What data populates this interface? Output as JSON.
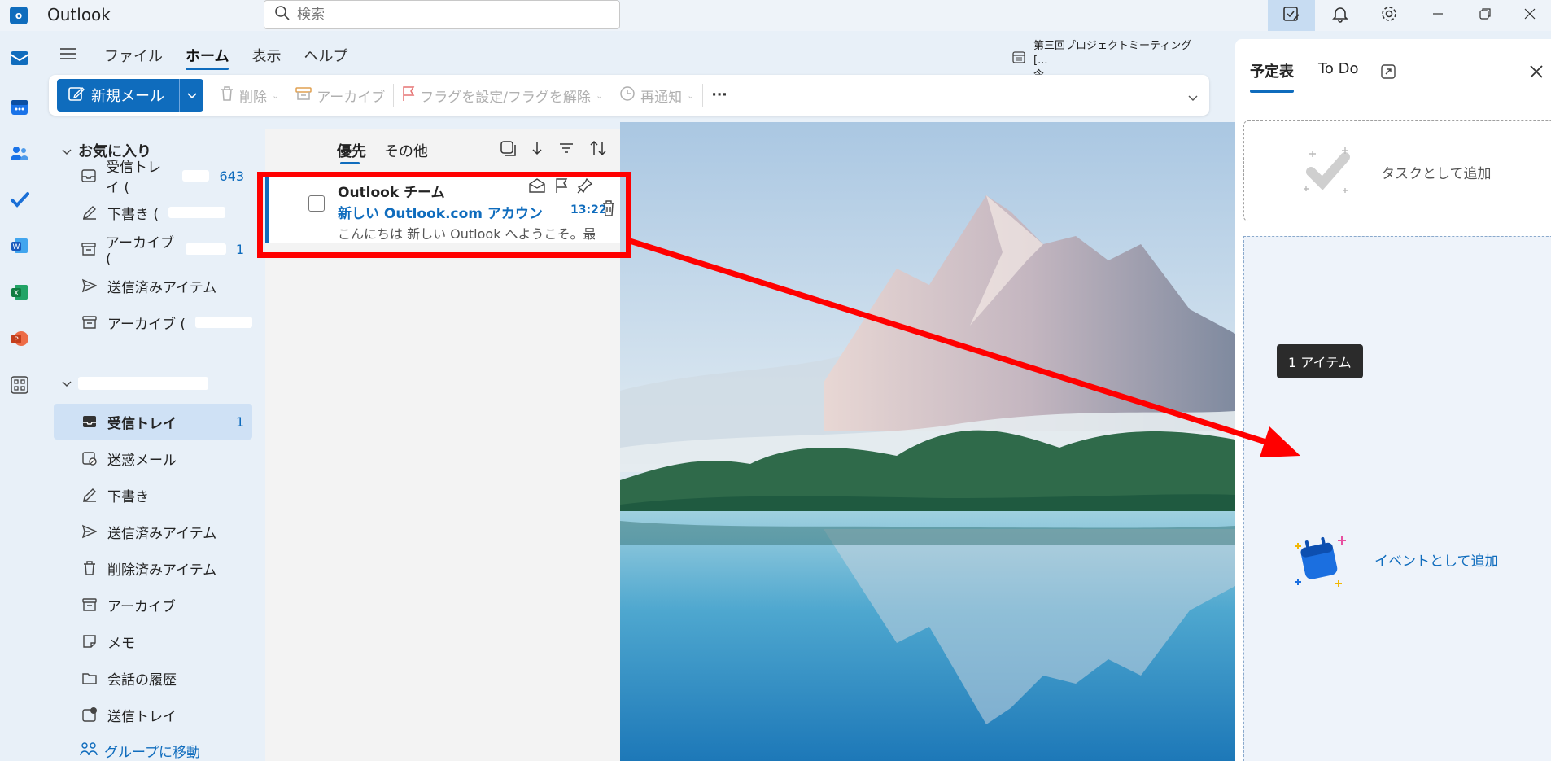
{
  "app": {
    "title": "Outlook",
    "logo_letter": "o"
  },
  "search": {
    "placeholder": "検索"
  },
  "ribbon": {
    "tabs": [
      "ファイル",
      "ホーム",
      "表示",
      "ヘルプ"
    ],
    "active_tab": "ホーム",
    "reminder": {
      "title": "第三回プロジェクトミーティング [...",
      "when": "今"
    },
    "new_mail": "新規メール",
    "tools": {
      "delete": "削除",
      "archive": "アーカイブ",
      "flag": "フラグを設定/フラグを解除",
      "snooze": "再通知",
      "more": "···"
    }
  },
  "folders": {
    "favorites_header": "お気に入り",
    "favorites": [
      {
        "label": "受信トレイ (",
        "count": "643"
      },
      {
        "label": "下書き (",
        "count": ""
      },
      {
        "label": "アーカイブ (",
        "count": "1"
      },
      {
        "label": "送信済みアイテム",
        "count": ""
      },
      {
        "label": "アーカイブ (",
        "count": ""
      }
    ],
    "account": [
      {
        "label": "受信トレイ",
        "count": "1"
      },
      {
        "label": "迷惑メール",
        "count": ""
      },
      {
        "label": "下書き",
        "count": ""
      },
      {
        "label": "送信済みアイテム",
        "count": ""
      },
      {
        "label": "削除済みアイテム",
        "count": ""
      },
      {
        "label": "アーカイブ",
        "count": ""
      },
      {
        "label": "メモ",
        "count": ""
      },
      {
        "label": "会話の履歴",
        "count": ""
      },
      {
        "label": "送信トレイ",
        "count": ""
      }
    ],
    "group_link": "グループに移動"
  },
  "message_list": {
    "tabs": [
      "優先",
      "その他"
    ],
    "active_tab": "優先",
    "message": {
      "sender": "Outlook チーム",
      "subject": "新しい Outlook.com アカウントへ...",
      "time": "13:22",
      "preview": "こんにちは 新しい Outlook へようこそ。最新..."
    }
  },
  "right_pane": {
    "tabs": [
      "予定表",
      "To Do"
    ],
    "active_tab": "予定表",
    "task_drop_label": "タスクとして追加",
    "event_drop_label": "イベントとして追加",
    "drag_tooltip": "1 アイテム"
  },
  "colors": {
    "accent": "#0f6cbd",
    "highlight": "#ff0000"
  }
}
